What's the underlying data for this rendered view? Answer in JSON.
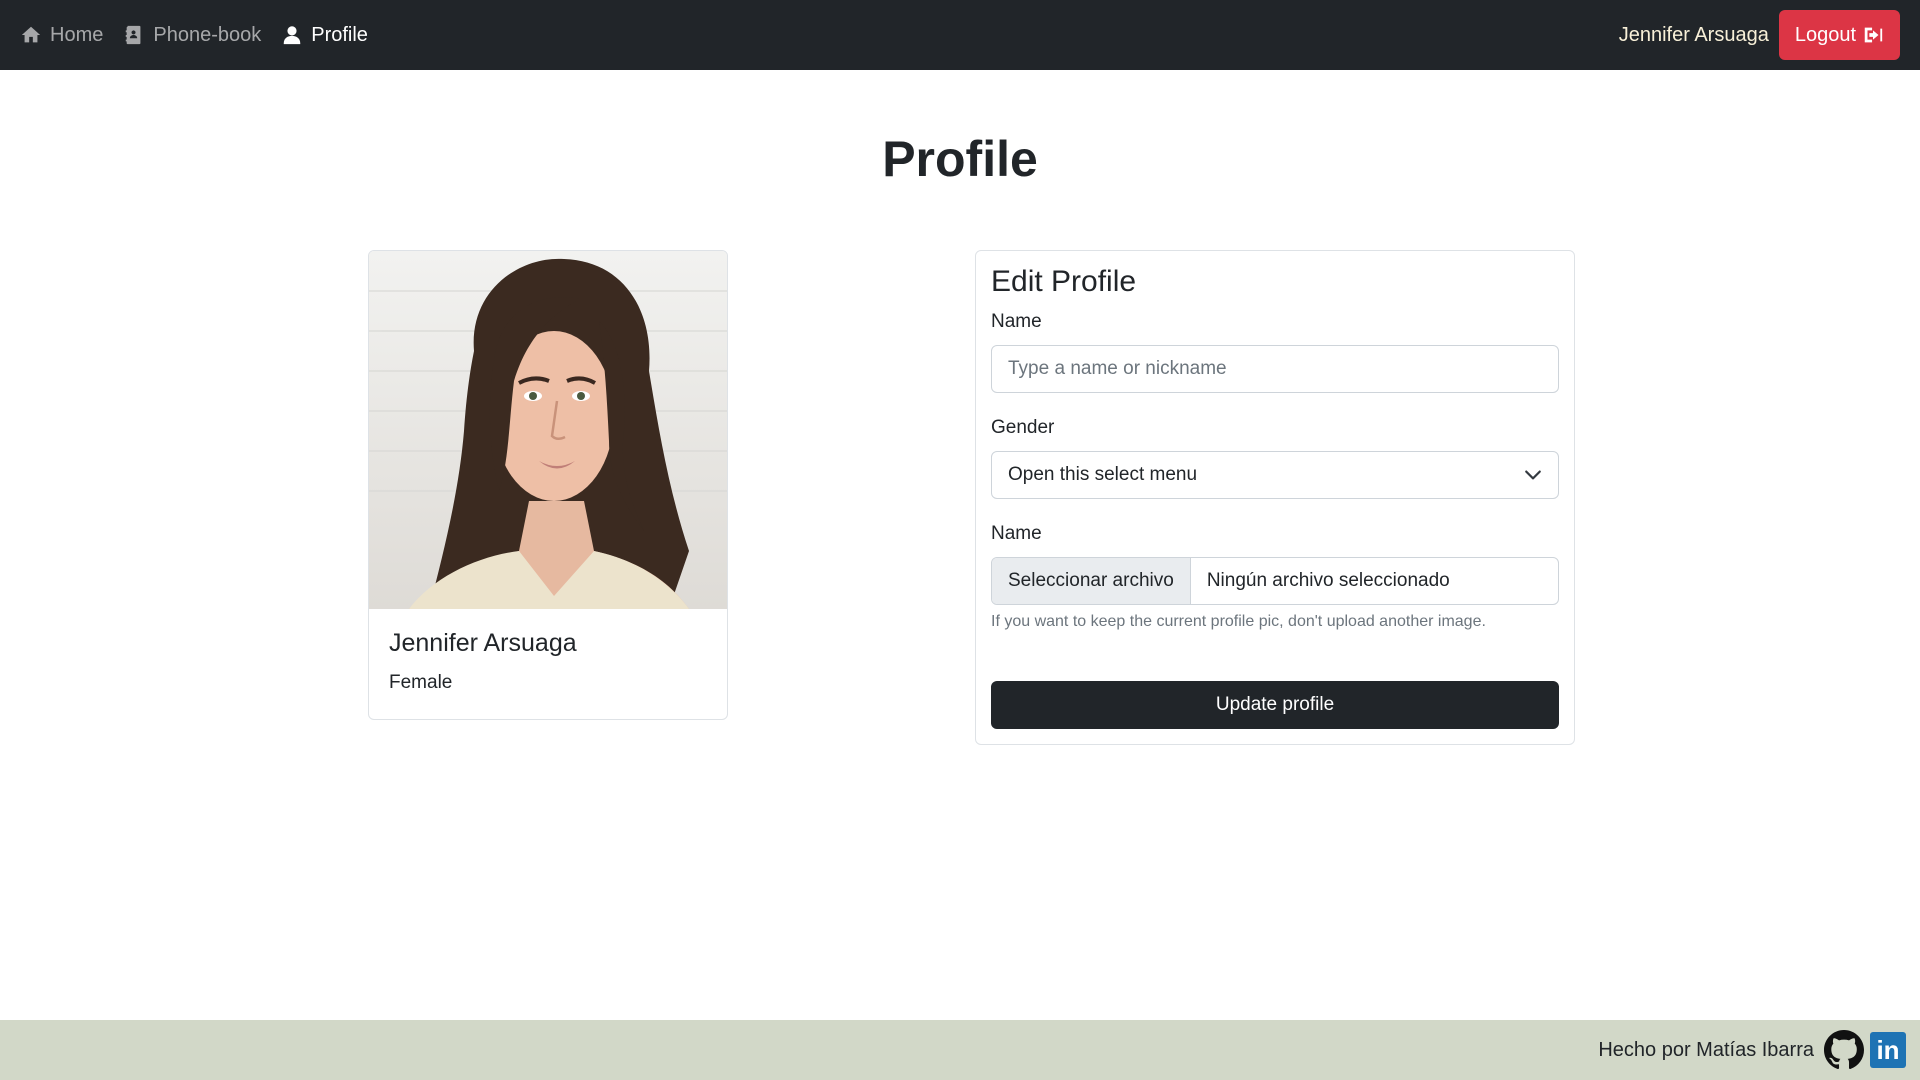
{
  "navbar": {
    "items": [
      {
        "label": "Home",
        "icon": "home-icon"
      },
      {
        "label": "Phone-book",
        "icon": "address-book-icon"
      },
      {
        "label": "Profile",
        "icon": "user-icon"
      }
    ],
    "user_name": "Jennifer Arsuaga",
    "logout_label": "Logout"
  },
  "page": {
    "title": "Profile"
  },
  "profile_card": {
    "name": "Jennifer Arsuaga",
    "gender": "Female"
  },
  "edit_form": {
    "title": "Edit Profile",
    "name_label": "Name",
    "name_placeholder": "Type a name or nickname",
    "gender_label": "Gender",
    "gender_selected": "Open this select menu",
    "file_label": "Name",
    "file_button": "Seleccionar archivo",
    "file_status": "Ningún archivo seleccionado",
    "file_help": "If you want to keep the current profile pic, don't upload another image.",
    "submit_label": "Update profile"
  },
  "footer": {
    "text": "Hecho por Matías Ibarra",
    "linkedin_glyph": "in"
  },
  "colors": {
    "navbar_bg": "#212529",
    "logout_bg": "#dc3545",
    "footer_bg": "#d2d8c8",
    "submit_bg": "#212529"
  }
}
